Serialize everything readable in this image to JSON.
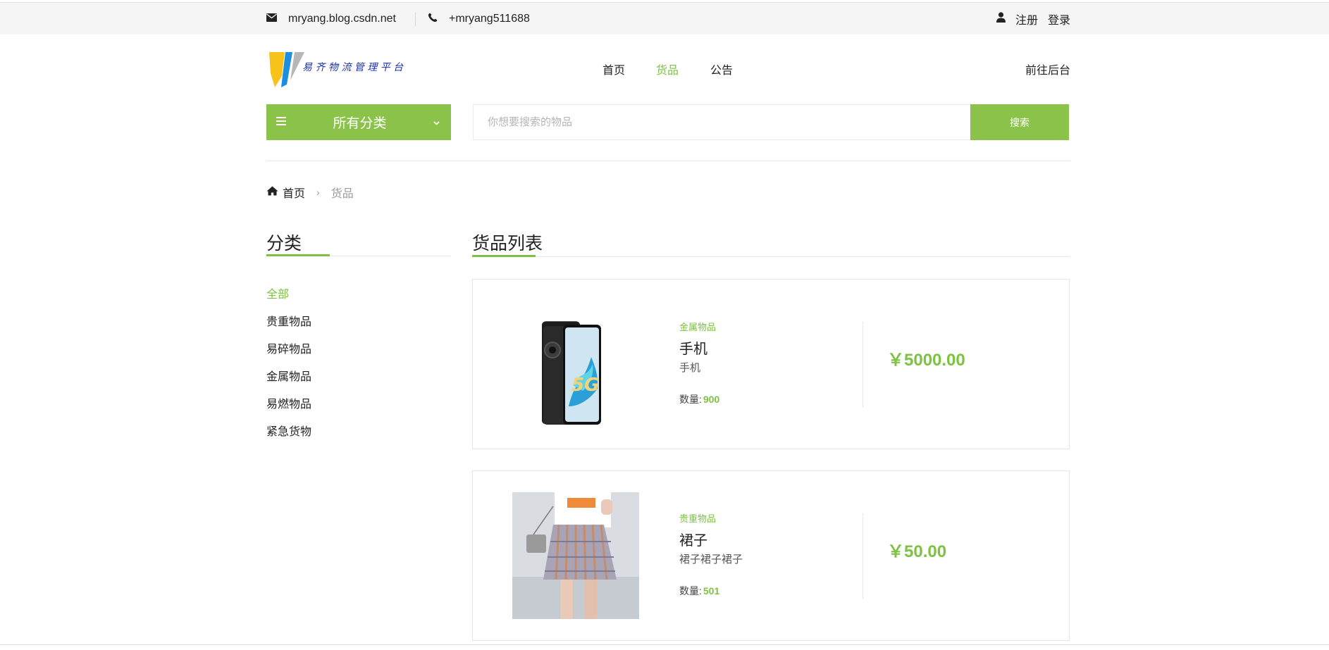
{
  "topbar": {
    "email": "mryang.blog.csdn.net",
    "phone": "+mryang511688",
    "register": "注册",
    "login": "登录"
  },
  "header": {
    "logo_text": "易齐物流管理平台",
    "nav": [
      {
        "label": "首页",
        "active": false
      },
      {
        "label": "货品",
        "active": true
      },
      {
        "label": "公告",
        "active": false
      }
    ],
    "backend_link": "前往后台"
  },
  "category_button": {
    "label": "所有分类"
  },
  "search": {
    "placeholder": "你想要搜索的物品",
    "button": "搜索"
  },
  "breadcrumb": {
    "home": "首页",
    "current": "货品"
  },
  "sidebar": {
    "title": "分类",
    "items": [
      {
        "label": "全部",
        "active": true
      },
      {
        "label": "贵重物品",
        "active": false
      },
      {
        "label": "易碎物品",
        "active": false
      },
      {
        "label": "金属物品",
        "active": false
      },
      {
        "label": "易燃物品",
        "active": false
      },
      {
        "label": "紧急货物",
        "active": false
      }
    ]
  },
  "main": {
    "title": "货品列表",
    "qty_label": "数量:",
    "products": [
      {
        "category": "金属物品",
        "name": "手机",
        "description": "手机",
        "quantity": "900",
        "price": "￥5000.00",
        "image_label": "5G"
      },
      {
        "category": "贵重物品",
        "name": "裙子",
        "description": "裙子裙子裙子",
        "quantity": "501",
        "price": "￥50.00"
      }
    ]
  },
  "colors": {
    "accent": "#8bc34a",
    "accent_text": "#7dc242",
    "topbar_bg": "#f5f5f5"
  }
}
